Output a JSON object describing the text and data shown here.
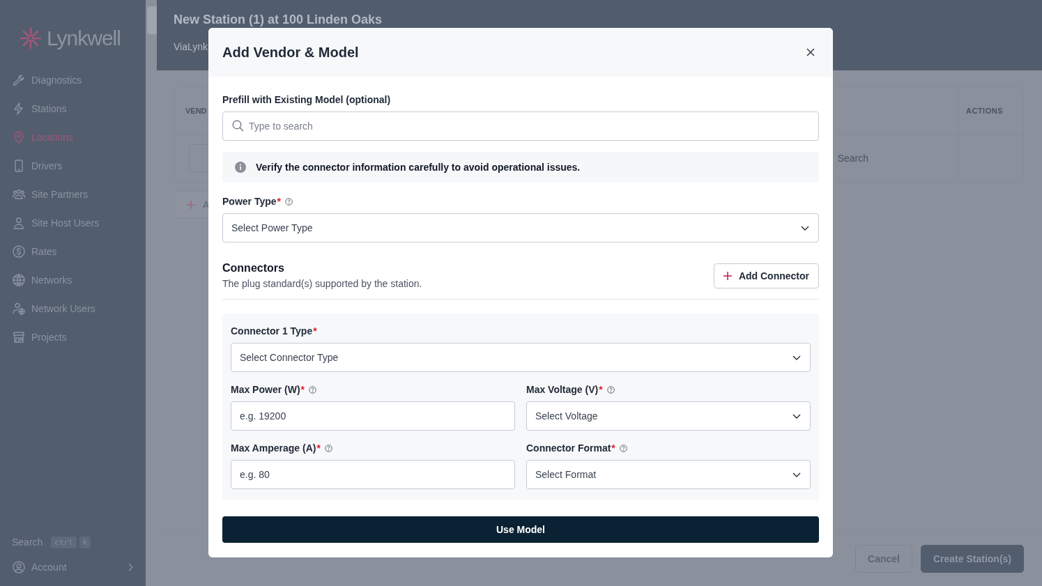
{
  "sidebar": {
    "logo": "Lynkwell",
    "items": [
      {
        "label": "Diagnostics",
        "selected": false
      },
      {
        "label": "Stations",
        "selected": false
      },
      {
        "label": "Locations",
        "selected": true
      },
      {
        "label": "Drivers",
        "selected": false
      },
      {
        "label": "Site Partners",
        "selected": false
      },
      {
        "label": "Site Host Users",
        "selected": false
      },
      {
        "label": "Rates",
        "selected": false
      },
      {
        "label": "Networks",
        "selected": false
      },
      {
        "label": "Network Users",
        "selected": false
      },
      {
        "label": "Projects",
        "selected": false
      }
    ],
    "search": {
      "label": "Search",
      "keys": [
        "ctrl",
        "k"
      ]
    },
    "account": "Account"
  },
  "page": {
    "title": "New Station (1) at 100 Linden Oaks",
    "subtitle": "ViaLynk",
    "table": {
      "columns": [
        "VEND",
        "ACTIONS"
      ],
      "search_placeholder": "Search"
    },
    "add_button": "A",
    "buttons": [
      {
        "label": "Cancel",
        "kind": "secondary"
      },
      {
        "label": "Create Station(s)",
        "kind": "primary"
      }
    ]
  },
  "modal": {
    "title": "Add Vendor & Model",
    "prefill": {
      "label": "Prefill with Existing Model (optional)",
      "placeholder": "Type to search"
    },
    "notice": "Verify the connector information carefully to avoid operational issues.",
    "power_type": {
      "label": "Power Type",
      "required_mark": "*",
      "help": true,
      "kind": "select",
      "placeholder": "Select Power Type"
    },
    "connectors": {
      "title": "Connectors",
      "description": "The plug standard(s) supported by the station.",
      "add_button": "Add Connector",
      "items": [
        {
          "type_field": {
            "label": "Connector 1 Type",
            "required_mark": "*",
            "help": false,
            "kind": "select",
            "placeholder": "Select Connector Type"
          },
          "fields": [
            {
              "label": "Max Power (W)",
              "required_mark": "*",
              "help": true,
              "kind": "input",
              "placeholder": "e.g. 19200"
            },
            {
              "label": "Max Voltage (V)",
              "required_mark": "*",
              "help": true,
              "kind": "select",
              "placeholder": "Select Voltage"
            },
            {
              "label": "Max Amperage (A)",
              "required_mark": "*",
              "help": true,
              "kind": "input",
              "placeholder": "e.g. 80"
            },
            {
              "label": "Connector Format",
              "required_mark": "*",
              "help": true,
              "kind": "select",
              "placeholder": "Select Format"
            }
          ]
        }
      ]
    },
    "submit": "Use Model"
  }
}
